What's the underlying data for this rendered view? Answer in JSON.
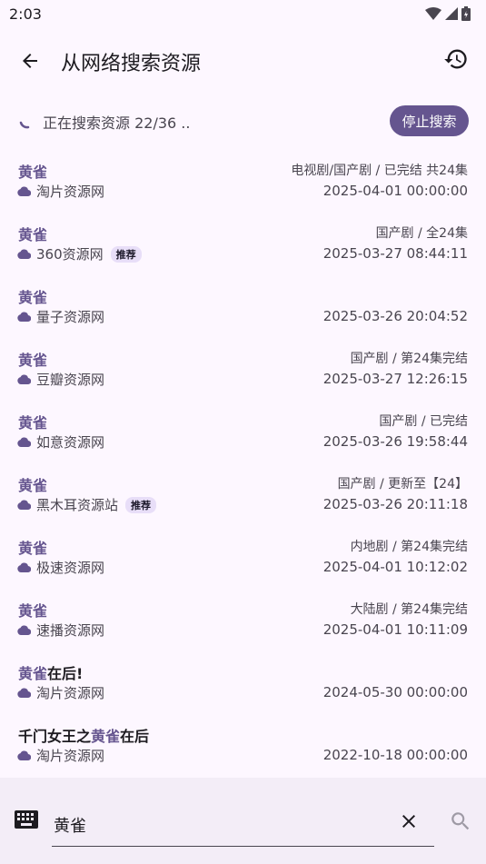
{
  "status_bar": {
    "time": "2:03"
  },
  "app_bar": {
    "title": "从网络搜索资源"
  },
  "progress": {
    "text": "正在搜索资源 22/36 ..",
    "stop_label": "停止搜索"
  },
  "results": [
    {
      "title_hl": "黄雀",
      "title_rest": "",
      "title_pre": "",
      "meta": "电视剧/国产剧 / 已完结 共24集",
      "source": "淘片资源网",
      "badge": "",
      "date": "2025-04-01 00:00:00"
    },
    {
      "title_hl": "黄雀",
      "title_rest": "",
      "title_pre": "",
      "meta": "国产剧 / 全24集",
      "source": "360资源网",
      "badge": "推荐",
      "date": "2025-03-27 08:44:11"
    },
    {
      "title_hl": "黄雀",
      "title_rest": "",
      "title_pre": "",
      "meta": "",
      "source": "量子资源网",
      "badge": "",
      "date": "2025-03-26 20:04:52"
    },
    {
      "title_hl": "黄雀",
      "title_rest": "",
      "title_pre": "",
      "meta": "国产剧 / 第24集完结",
      "source": "豆瓣资源网",
      "badge": "",
      "date": "2025-03-27 12:26:15"
    },
    {
      "title_hl": "黄雀",
      "title_rest": "",
      "title_pre": "",
      "meta": "国产剧 / 已完结",
      "source": "如意资源网",
      "badge": "",
      "date": "2025-03-26 19:58:44"
    },
    {
      "title_hl": "黄雀",
      "title_rest": "",
      "title_pre": "",
      "meta": "国产剧 / 更新至【24】",
      "source": "黑木耳资源站",
      "badge": "推荐",
      "date": "2025-03-26 20:11:18"
    },
    {
      "title_hl": "黄雀",
      "title_rest": "",
      "title_pre": "",
      "meta": "内地剧 / 第24集完结",
      "source": "极速资源网",
      "badge": "",
      "date": "2025-04-01 10:12:02"
    },
    {
      "title_hl": "黄雀",
      "title_rest": "",
      "title_pre": "",
      "meta": "大陆剧 / 第24集完结",
      "source": "速播资源网",
      "badge": "",
      "date": "2025-04-01 10:11:09"
    },
    {
      "title_hl": "黄雀",
      "title_rest": "在后!",
      "title_pre": "",
      "meta": "",
      "source": "淘片资源网",
      "badge": "",
      "date": "2024-05-30 00:00:00"
    },
    {
      "title_hl": "黄雀",
      "title_rest": "在后",
      "title_pre": "千门女王之",
      "meta": "",
      "source": "淘片资源网",
      "badge": "",
      "date": "2022-10-18 00:00:00"
    }
  ],
  "search": {
    "value": "黄雀"
  },
  "colors": {
    "accent": "#65558f",
    "background": "#fdf7ff",
    "bottom_bar": "#f3edf7"
  },
  "icons": {
    "back": "arrow-left-icon",
    "history": "history-icon",
    "keyboard": "keyboard-icon",
    "clear": "close-icon",
    "search": "search-icon",
    "source": "cloud-icon"
  }
}
